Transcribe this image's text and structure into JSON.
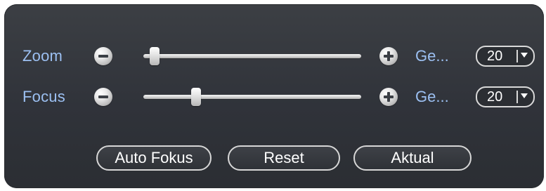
{
  "ptz_panel": {
    "zoom": {
      "label": "Zoom",
      "slider_fraction": 0.03,
      "speed_label": "Ge...",
      "speed_value": "20"
    },
    "focus": {
      "label": "Focus",
      "slider_fraction": 0.23,
      "speed_label": "Ge...",
      "speed_value": "20"
    },
    "buttons": {
      "auto_focus": "Auto Fokus",
      "reset": "Reset",
      "actual": "Aktual"
    },
    "icons": {
      "minus": "minus-icon",
      "plus": "plus-icon",
      "dropdown": "chevron-down-icon"
    },
    "colors": {
      "label_blue": "#9cc0f2",
      "panel_bg": "#30333a",
      "text_white": "#ffffff"
    }
  }
}
